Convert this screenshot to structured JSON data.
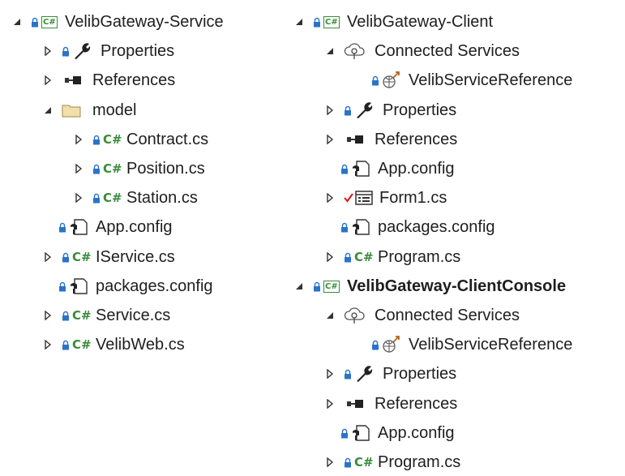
{
  "left": [
    {
      "label": "VelibGateway-Service",
      "icon": "csharp-project-icon",
      "expander": "expanded",
      "depth": 0,
      "bold": false
    },
    {
      "label": "Properties",
      "icon": "properties-wrench-icon",
      "expander": "collapsed",
      "depth": 1,
      "bold": false
    },
    {
      "label": "References",
      "icon": "references-icon",
      "expander": "collapsed",
      "depth": 1,
      "bold": false
    },
    {
      "label": "model",
      "icon": "folder-icon",
      "expander": "expanded",
      "depth": 1,
      "bold": false
    },
    {
      "label": "Contract.cs",
      "icon": "csharp-file-icon",
      "expander": "collapsed",
      "depth": 2,
      "bold": false
    },
    {
      "label": "Position.cs",
      "icon": "csharp-file-icon",
      "expander": "collapsed",
      "depth": 2,
      "bold": false
    },
    {
      "label": "Station.cs",
      "icon": "csharp-file-icon",
      "expander": "collapsed",
      "depth": 2,
      "bold": false
    },
    {
      "label": "App.config",
      "icon": "config-file-icon",
      "expander": "none",
      "depth": 1,
      "bold": false
    },
    {
      "label": "IService.cs",
      "icon": "csharp-file-icon",
      "expander": "collapsed",
      "depth": 1,
      "bold": false
    },
    {
      "label": "packages.config",
      "icon": "config-file-icon",
      "expander": "none",
      "depth": 1,
      "bold": false
    },
    {
      "label": "Service.cs",
      "icon": "csharp-file-icon",
      "expander": "collapsed",
      "depth": 1,
      "bold": false
    },
    {
      "label": "VelibWeb.cs",
      "icon": "csharp-file-icon",
      "expander": "collapsed",
      "depth": 1,
      "bold": false
    }
  ],
  "right": [
    {
      "label": "VelibGateway-Client",
      "icon": "csharp-project-icon",
      "expander": "expanded",
      "depth": 0,
      "bold": false
    },
    {
      "label": "Connected Services",
      "icon": "connected-services-icon",
      "expander": "expanded",
      "depth": 1,
      "bold": false
    },
    {
      "label": "VelibServiceReference",
      "icon": "service-reference-icon",
      "expander": "none",
      "depth": 2,
      "bold": false
    },
    {
      "label": "Properties",
      "icon": "properties-wrench-icon",
      "expander": "collapsed",
      "depth": 1,
      "bold": false
    },
    {
      "label": "References",
      "icon": "references-icon",
      "expander": "collapsed",
      "depth": 1,
      "bold": false
    },
    {
      "label": "App.config",
      "icon": "config-file-icon",
      "expander": "none",
      "depth": 1,
      "bold": false
    },
    {
      "label": "Form1.cs",
      "icon": "form-file-icon",
      "expander": "collapsed",
      "depth": 1,
      "bold": false
    },
    {
      "label": "packages.config",
      "icon": "config-file-icon",
      "expander": "none",
      "depth": 1,
      "bold": false
    },
    {
      "label": "Program.cs",
      "icon": "csharp-file-icon",
      "expander": "collapsed",
      "depth": 1,
      "bold": false
    },
    {
      "label": "VelibGateway-ClientConsole",
      "icon": "csharp-project-icon",
      "expander": "expanded",
      "depth": 0,
      "bold": true
    },
    {
      "label": "Connected Services",
      "icon": "connected-services-icon",
      "expander": "expanded",
      "depth": 1,
      "bold": false
    },
    {
      "label": "VelibServiceReference",
      "icon": "service-reference-icon",
      "expander": "none",
      "depth": 2,
      "bold": false
    },
    {
      "label": "Properties",
      "icon": "properties-wrench-icon",
      "expander": "collapsed",
      "depth": 1,
      "bold": false
    },
    {
      "label": "References",
      "icon": "references-icon",
      "expander": "collapsed",
      "depth": 1,
      "bold": false
    },
    {
      "label": "App.config",
      "icon": "config-file-icon",
      "expander": "none",
      "depth": 1,
      "bold": false
    },
    {
      "label": "Program.cs",
      "icon": "csharp-file-icon",
      "expander": "collapsed",
      "depth": 1,
      "bold": false
    }
  ]
}
